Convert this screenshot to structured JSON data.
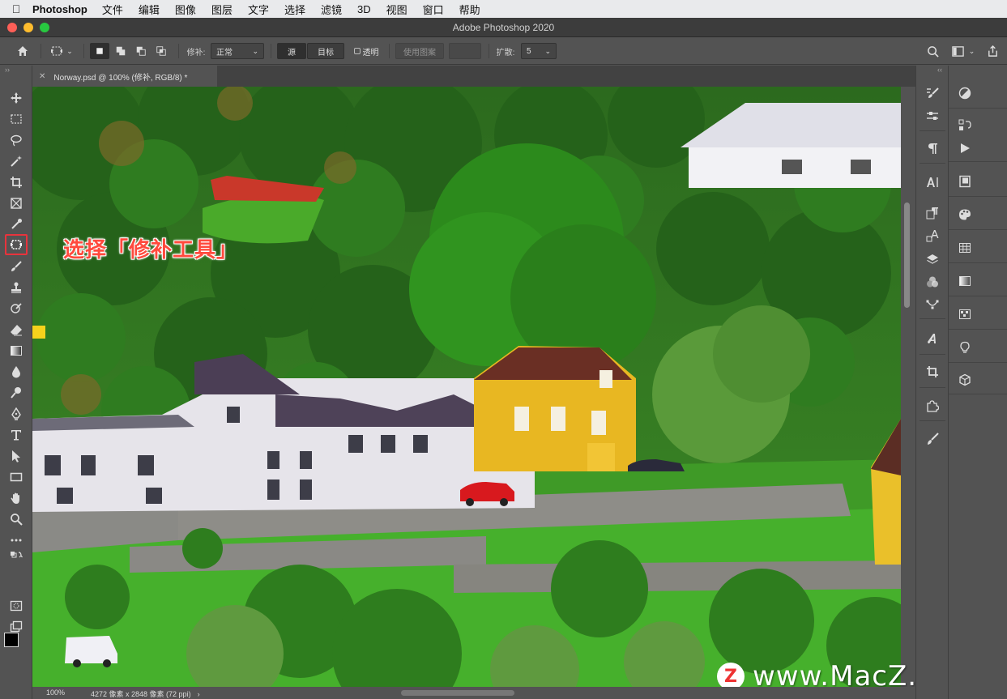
{
  "menubar": {
    "app_name": "Photoshop",
    "items": [
      "文件",
      "编辑",
      "图像",
      "图层",
      "文字",
      "选择",
      "滤镜",
      "3D",
      "视图",
      "窗口",
      "帮助"
    ]
  },
  "window": {
    "title": "Adobe Photoshop 2020"
  },
  "options": {
    "patch_label": "修补:",
    "patch_mode": "正常",
    "source_label": "源",
    "target_label": "目标",
    "transparent_label": "透明",
    "use_pattern_label": "使用图案",
    "diffusion_label": "扩散:",
    "diffusion_value": "5"
  },
  "document": {
    "tab_title": "Norway.psd @ 100% (修补, RGB/8) *",
    "zoom": "100%",
    "info": "4272 像素 x 2848 像素 (72 ppi)"
  },
  "annotation": {
    "text": "选择「修补工具」"
  },
  "watermark": {
    "logo_letter": "Z",
    "text": "www.MacZ.com"
  },
  "colors": {
    "highlight": "#e8333c",
    "annotation": "#ff4a3d"
  }
}
